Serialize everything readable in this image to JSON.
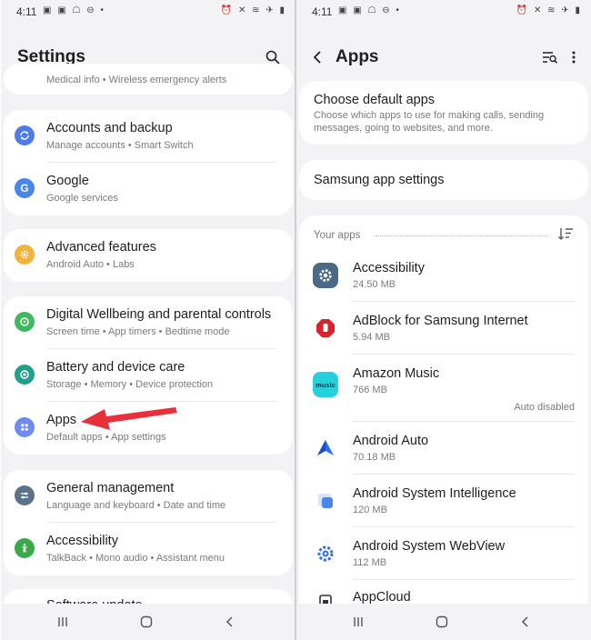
{
  "status_bar": {
    "time": "4:11",
    "notification_icons": [
      "image-icon",
      "image-icon",
      "chat-icon",
      "blocked-icon",
      "dot-icon"
    ],
    "system_icons": [
      "alarm-icon",
      "vibrate-icon",
      "wifi-call-icon",
      "airplane-icon",
      "battery-icon"
    ]
  },
  "settings": {
    "title": "Settings",
    "search_icon": "search-icon",
    "top_partial_text": "Medical info  •  Wireless emergency alerts",
    "groups": [
      {
        "items": [
          {
            "title": "Accounts and backup",
            "subtitle": "Manage accounts  •  Smart Switch",
            "icon": "sync-icon",
            "color": "#4f7be8"
          },
          {
            "title": "Google",
            "subtitle": "Google services",
            "icon": "google-icon",
            "color": "#4a86e8"
          }
        ]
      },
      {
        "items": [
          {
            "title": "Advanced features",
            "subtitle": "Android Auto  •  Labs",
            "icon": "gear-plus-icon",
            "color": "#f2b33d"
          }
        ]
      },
      {
        "items": [
          {
            "title": "Digital Wellbeing and parental controls",
            "subtitle": "Screen time  •  App timers  •  Bedtime mode",
            "icon": "wellbeing-icon",
            "color": "#3fb85f"
          },
          {
            "title": "Battery and device care",
            "subtitle": "Storage  •  Memory  •  Device protection",
            "icon": "device-care-icon",
            "color": "#22a08a"
          },
          {
            "title": "Apps",
            "subtitle": "Default apps  •  App settings",
            "icon": "apps-grid-icon",
            "color": "#6e8cf0"
          }
        ]
      },
      {
        "items": [
          {
            "title": "General management",
            "subtitle": "Language and keyboard  •  Date and time",
            "icon": "sliders-icon",
            "color": "#5a7388"
          },
          {
            "title": "Accessibility",
            "subtitle": "TalkBack  •  Mono audio  •  Assistant menu",
            "icon": "accessibility-person-icon",
            "color": "#3aa94a"
          }
        ]
      }
    ],
    "bottom_partial_text": "Software update",
    "annotation_color": "#e8303b"
  },
  "apps": {
    "title": "Apps",
    "back_icon": "back-arrow-icon",
    "filter_icon": "filter-search-icon",
    "more_icon": "more-vertical-icon",
    "choose_default": {
      "title": "Choose default apps",
      "description": "Choose which apps to use for making calls, sending messages, going to websites, and more."
    },
    "samsung_settings": {
      "title": "Samsung app settings"
    },
    "your_apps_label": "Your apps",
    "sort_icon": "sort-icon",
    "list": [
      {
        "name": "Accessibility",
        "size": "24.50 MB",
        "status": "",
        "icon": "gear-icon",
        "color": "#4a6a86"
      },
      {
        "name": "AdBlock for Samsung Internet",
        "size": "5.94 MB",
        "status": "",
        "icon": "stop-hand-icon",
        "color": "#d8232a"
      },
      {
        "name": "Amazon Music",
        "size": "766 MB",
        "status": "Auto disabled",
        "icon": "amazon-music-icon",
        "color": "#25d1da"
      },
      {
        "name": "Android Auto",
        "size": "70.18 MB",
        "status": "",
        "icon": "android-auto-icon",
        "color": "#2d6df6"
      },
      {
        "name": "Android System Intelligence",
        "size": "120 MB",
        "status": "",
        "icon": "system-intelligence-icon",
        "color": "#4a86e8"
      },
      {
        "name": "Android System WebView",
        "size": "112 MB",
        "status": "",
        "icon": "webview-gear-icon",
        "color": "#2f6fe0"
      },
      {
        "name": "AppCloud",
        "size": "",
        "status": "",
        "icon": "appcloud-icon",
        "color": "#333333"
      }
    ]
  },
  "nav": {
    "recents_icon": "recents-icon",
    "home_icon": "home-icon",
    "back_icon": "nav-back-icon"
  }
}
